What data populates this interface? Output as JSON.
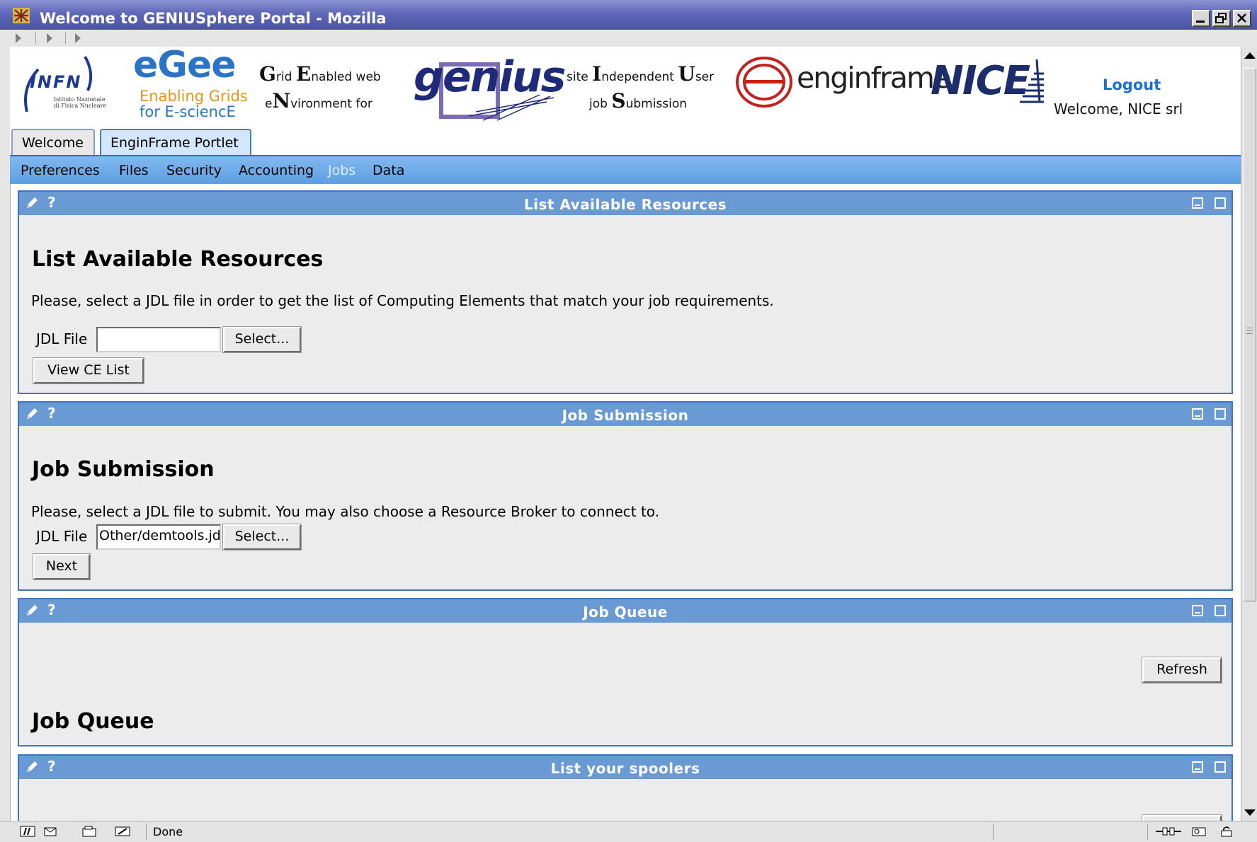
{
  "window": {
    "title": "Welcome to GENIUSphere Portal - Mozilla",
    "buttons": [
      "_",
      "▫",
      "✕"
    ]
  },
  "header": {
    "infn_text": "INFN",
    "infn_sub": "Istituto Nazionale di Fisica Nucleare",
    "egee_word": "eGee",
    "egee_line1": "Enabling Grids",
    "egee_line2": "for E-sciencE",
    "genius_word": "genius",
    "acronym_left": {
      "line1": [
        {
          "cap": "G",
          "rest": "rid"
        },
        {
          "cap": "E",
          "rest": "nabled web"
        }
      ],
      "line2": [
        {
          "cap": "N",
          "rest": "vironment for"
        }
      ],
      "line2_prefix": "e"
    },
    "acronym_right": {
      "line1_prefix": "site",
      "line1": [
        {
          "cap": "I",
          "rest": "ndependent"
        },
        {
          "cap": "U",
          "rest": "ser"
        }
      ],
      "line2_prefix": "job",
      "line2": [
        {
          "cap": "S",
          "rest": "ubmission"
        }
      ]
    },
    "enginframe_word": "enginframe",
    "enginframe_in": "in",
    "nice_word": "NICE",
    "logout": "Logout",
    "welcome": "Welcome, NICE srl"
  },
  "tabs": [
    {
      "label": "Welcome",
      "active": false
    },
    {
      "label": "EnginFrame Portlet",
      "active": true
    }
  ],
  "subnav": [
    {
      "label": "Preferences"
    },
    {
      "label": "Files"
    },
    {
      "label": "Security"
    },
    {
      "label": "Accounting"
    },
    {
      "label": "Jobs",
      "current": true
    },
    {
      "label": "Data"
    }
  ],
  "portlets": {
    "resources": {
      "title": "List Available Resources",
      "heading": "List Available Resources",
      "description": "Please, select a JDL file in order to get the list of Computing Elements that match your job requirements.",
      "jdl_label": "JDL File",
      "jdl_value": "",
      "select_button": "Select...",
      "view_button": "View CE List"
    },
    "submission": {
      "title": "Job Submission",
      "heading": "Job Submission",
      "description": "Please, select a JDL file to submit. You may also choose a Resource Broker to connect to.",
      "jdl_label": "JDL File",
      "jdl_value": "Other/demtools.jdl",
      "select_button": "Select...",
      "next_button": "Next"
    },
    "queue": {
      "title": "Job Queue",
      "heading": "Job Queue",
      "refresh_button": "Refresh"
    },
    "spoolers": {
      "title": "List your spoolers"
    },
    "help_symbol": "?"
  },
  "statusbar": {
    "text": "Done"
  },
  "colors": {
    "title_bar": "#5f67b8",
    "portlet_header": "#6a9ad4",
    "subnav": "#6fa9e8",
    "link": "#1a6fd1"
  }
}
